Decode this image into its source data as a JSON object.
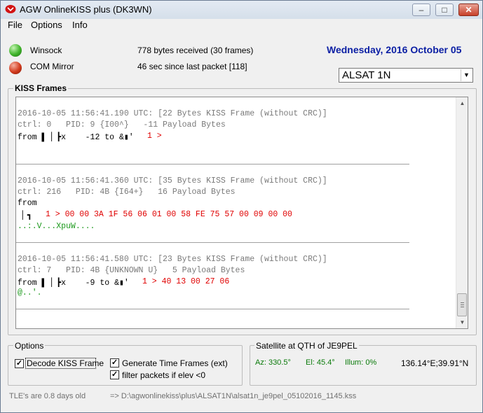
{
  "window": {
    "title": "AGW OnlineKISS plus (DK3WN)",
    "minimize": "–",
    "maximize": "□",
    "close": "✕"
  },
  "menu": [
    "File",
    "Options",
    "Info"
  ],
  "status_panel": {
    "winsock_label": "Winsock",
    "winsock_info": "778 bytes received (30 frames)",
    "com_label": "COM Mirror",
    "com_info": "46 sec since last packet [118]",
    "date": "Wednesday, 2016 October 05",
    "satellite_select": "ALSAT 1N",
    "colors": {
      "date": "#0b1fa4",
      "winsock_led": "green",
      "com_led": "red"
    }
  },
  "kiss_frames": {
    "title": "KISS Frames",
    "frames": [
      {
        "header": "2016-10-05 11:56:41.190 UTC: [22 Bytes KISS Frame (without CRC)]",
        "ctrl": "ctrl: 0   PID: 9 {I00^}   -11 Payload Bytes",
        "from": "from ▌ ▏┣x    -12 to &▮'",
        "hex": "1 >",
        "ascii": ""
      },
      {
        "header": "2016-10-05 11:56:41.360 UTC: [35 Bytes KISS Frame (without CRC)]",
        "ctrl": "ctrl: 216   PID: 4B {I64+}   16 Payload Bytes",
        "from": "from",
        "from2": " ▏┓",
        "hex": "1 > 00 00 3A 1F 56 06 01 00 58 FE 75 57 00 09 00 00",
        "ascii": "..:.V...XpuW...."
      },
      {
        "header": "2016-10-05 11:56:41.580 UTC: [23 Bytes KISS Frame (without CRC)]",
        "ctrl": "ctrl: 7   PID: 4B {UNKNOWN U}   5 Payload Bytes",
        "from": "from ▌ ▏┣x    -9 to &▮'",
        "hex": "1 > 40 13 00 27 06",
        "ascii": "@..'."
      }
    ]
  },
  "options": {
    "title": "Options",
    "decode_kiss": "Decode KISS Frame",
    "generate_time": "Generate Time Frames (ext)",
    "filter_packets": "filter packets if elev <0"
  },
  "satellite": {
    "title": "Satellite at QTH of JE9PEL",
    "az": "Az: 330.5°",
    "el": "El: 45.4°",
    "illum": "Illum: 0%",
    "position": "136.14°E;39.91°N"
  },
  "statusbar": {
    "tle": "TLE's are 0.8 days old",
    "file": "=> D:\\agwonlinekiss\\plus\\ALSAT1N\\alsat1n_je9pel_05102016_1145.kss"
  }
}
